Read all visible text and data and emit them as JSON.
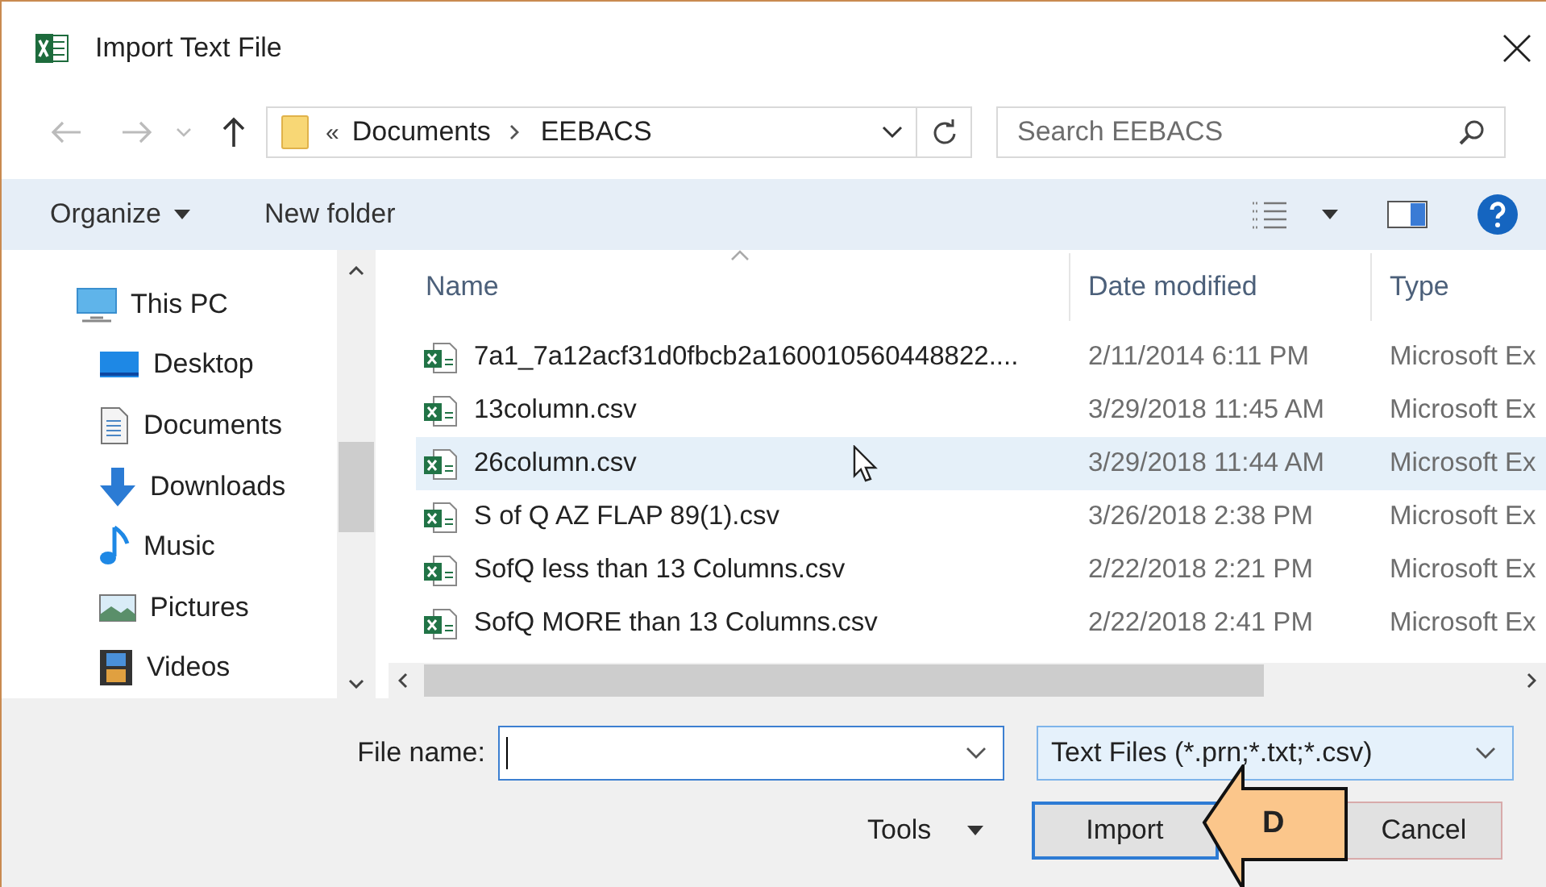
{
  "window": {
    "title": "Import Text File"
  },
  "address": {
    "overflow": "«",
    "path": [
      "Documents",
      "EEBACS"
    ]
  },
  "search": {
    "placeholder": "Search EEBACS"
  },
  "toolbar": {
    "organize": "Organize",
    "new_folder": "New folder"
  },
  "sidebar": {
    "items": [
      {
        "label": "This PC",
        "kind": "pc",
        "children": [
          {
            "label": "Desktop",
            "kind": "desktop"
          },
          {
            "label": "Documents",
            "kind": "documents"
          },
          {
            "label": "Downloads",
            "kind": "downloads"
          },
          {
            "label": "Music",
            "kind": "music"
          },
          {
            "label": "Pictures",
            "kind": "pictures"
          },
          {
            "label": "Videos",
            "kind": "videos"
          }
        ]
      }
    ]
  },
  "table": {
    "columns": [
      "Name",
      "Date modified",
      "Type"
    ],
    "rows": [
      {
        "name": "7a1_7a12acf31d0fbcb2a160010560448822....",
        "date": "2/11/2014 6:11 PM",
        "type": "Microsoft Ex",
        "selected": false
      },
      {
        "name": "13column.csv",
        "date": "3/29/2018 11:45 AM",
        "type": "Microsoft Ex",
        "selected": false
      },
      {
        "name": "26column.csv",
        "date": "3/29/2018 11:44 AM",
        "type": "Microsoft Ex",
        "selected": true
      },
      {
        "name": "S of Q AZ FLAP 89(1).csv",
        "date": "3/26/2018 2:38 PM",
        "type": "Microsoft Ex",
        "selected": false
      },
      {
        "name": "SofQ less than 13 Columns.csv",
        "date": "2/22/2018 2:21 PM",
        "type": "Microsoft Ex",
        "selected": false
      },
      {
        "name": "SofQ MORE than 13 Columns.csv",
        "date": "2/22/2018 2:41 PM",
        "type": "Microsoft Ex",
        "selected": false
      }
    ]
  },
  "file_name": {
    "label": "File name:"
  },
  "file_type": {
    "value": "Text Files (*.prn;*.txt;*.csv)"
  },
  "tools": {
    "label": "Tools"
  },
  "buttons": [
    {
      "label": "Import",
      "focused": true
    },
    {
      "label": "Cancel",
      "focused": false
    }
  ],
  "callout": {
    "label": "D"
  }
}
